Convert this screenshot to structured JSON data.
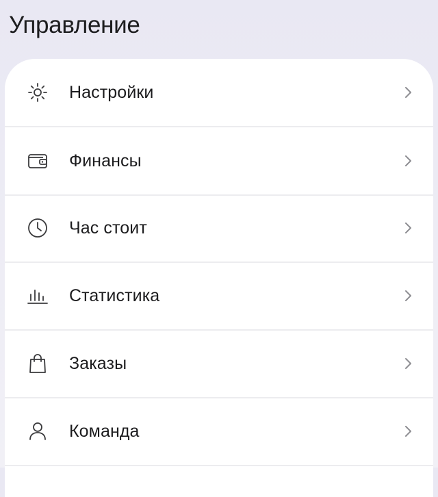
{
  "header": {
    "title": "Управление"
  },
  "menu": {
    "items": [
      {
        "id": "settings",
        "label": "Настройки",
        "icon": "sun-icon"
      },
      {
        "id": "finance",
        "label": "Финансы",
        "icon": "wallet-icon"
      },
      {
        "id": "hourly-rate",
        "label": "Час стоит",
        "icon": "clock-icon"
      },
      {
        "id": "statistics",
        "label": "Статистика",
        "icon": "bar-chart-icon"
      },
      {
        "id": "orders",
        "label": "Заказы",
        "icon": "shopping-bag-icon"
      },
      {
        "id": "team",
        "label": "Команда",
        "icon": "person-icon"
      }
    ]
  },
  "colors": {
    "background": "#eeedf5",
    "card": "#ffffff",
    "text": "#1c1c1e",
    "icon": "#3a3a3c",
    "chevron": "#8e8e93",
    "divider": "#ececef"
  }
}
